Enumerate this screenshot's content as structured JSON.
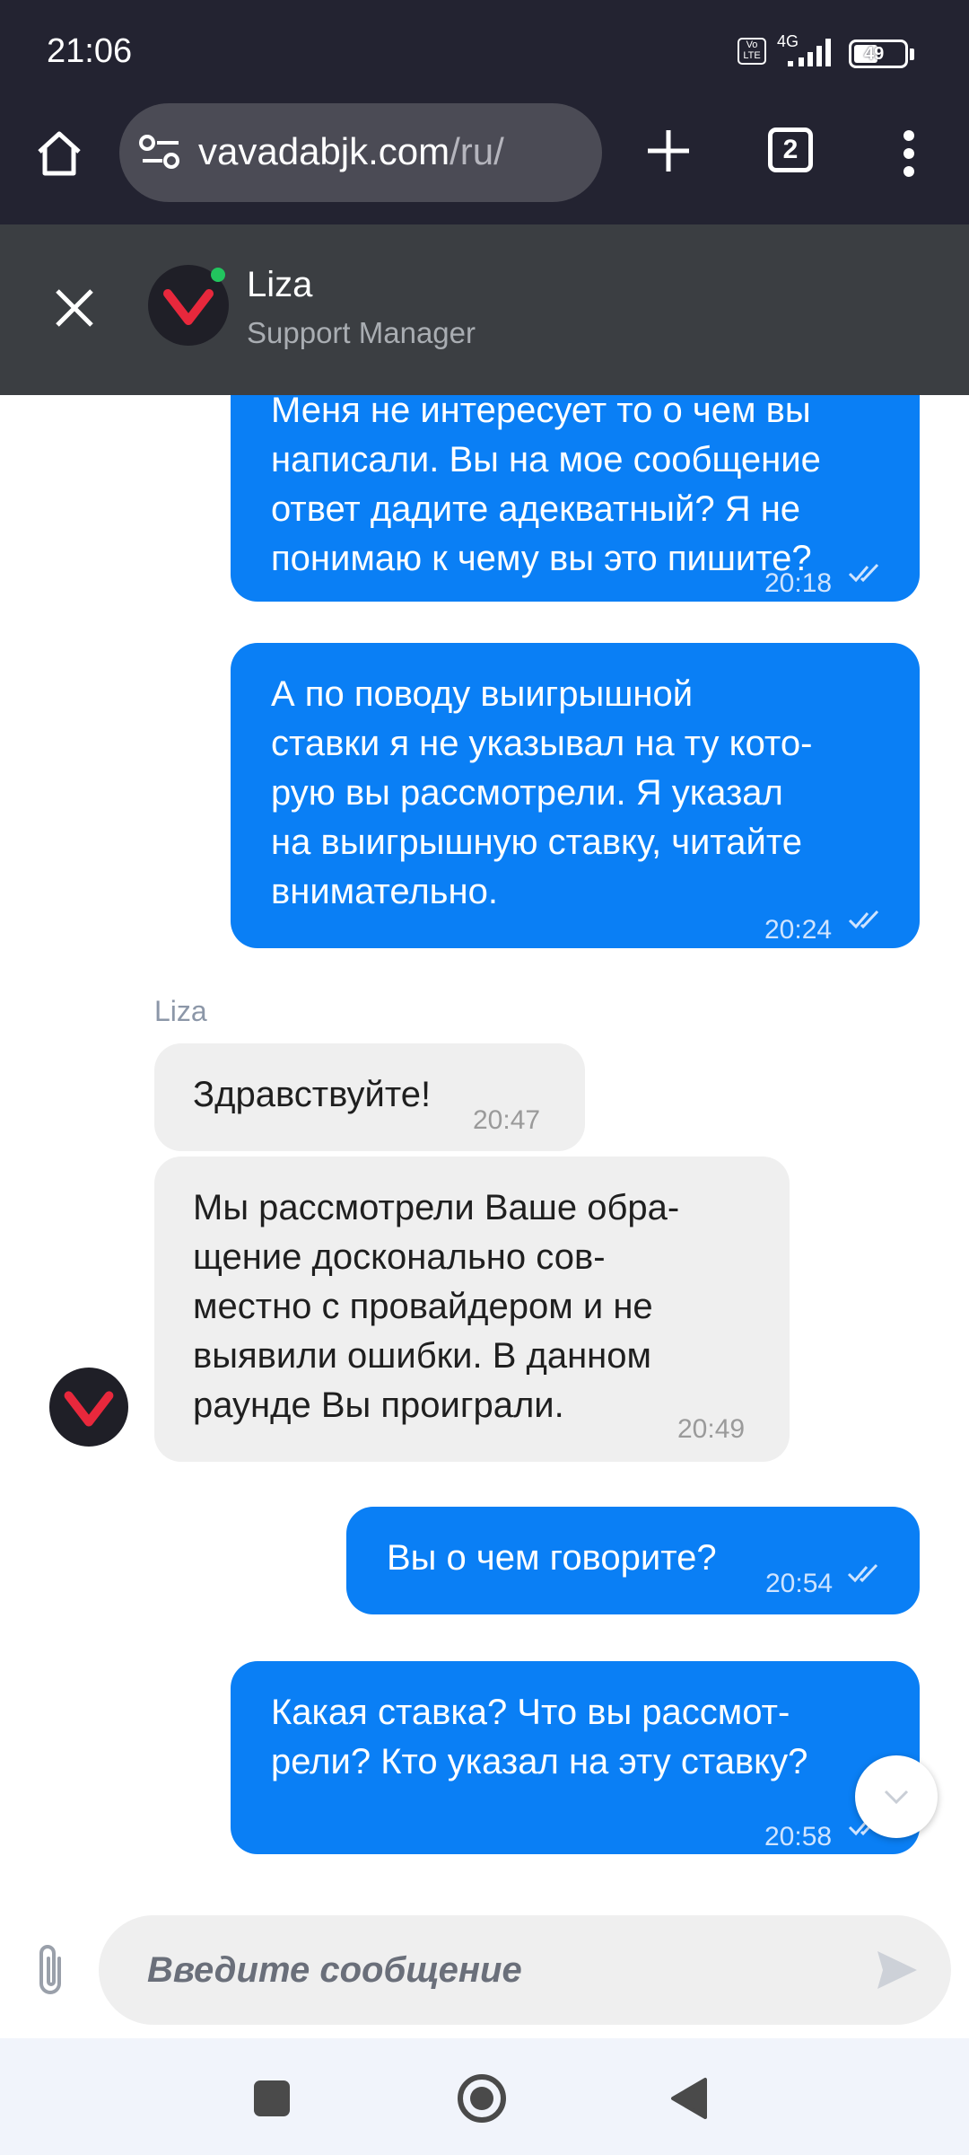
{
  "status_bar": {
    "time": "21:06",
    "network": "4G",
    "battery": "49"
  },
  "browser": {
    "url_domain": "vavadabjk.com",
    "url_path": "/ru/",
    "tab_count": "2"
  },
  "chat_header": {
    "name": "Liza",
    "role": "Support Manager"
  },
  "messages": [
    {
      "dir": "out",
      "text_lines": [
        "Меня не интересует то о чем вы",
        "написали. Вы на мое сообщение",
        "ответ дадите адекватный? Я не",
        "понимаю к чему вы это пишите?"
      ],
      "time": "20:18"
    },
    {
      "dir": "out",
      "text_lines": [
        "А по поводу выигрышной",
        "ставки я не указывал на ту кото-",
        "рую вы рассмотрели. Я указал",
        "на выигрышную ставку, читайте",
        "внимательно."
      ],
      "time": "20:24"
    },
    {
      "dir": "in",
      "sender": "Liza",
      "text_lines": [
        "Здравствуйте!"
      ],
      "time": "20:47"
    },
    {
      "dir": "in",
      "text_lines": [
        "Мы рассмотрели Ваше обра-",
        "щение досконально сов-",
        "местно с провайдером и не",
        "выявили ошибки. В данном",
        "раунде Вы проиграли."
      ],
      "time": "20:49"
    },
    {
      "dir": "out",
      "text_lines": [
        "Вы о чем говорите?"
      ],
      "time": "20:54"
    },
    {
      "dir": "out",
      "text_lines": [
        "Какая ставка? Что вы рассмот-",
        "рели? Кто указал на эту ставку?"
      ],
      "time": "20:58"
    }
  ],
  "composer": {
    "placeholder": "Введите сообщение"
  },
  "colors": {
    "outgoing": "#0a7ff5",
    "incoming": "#efefef",
    "header": "#3b3e42",
    "topbar": "#232331",
    "brand": "#e8283c"
  }
}
